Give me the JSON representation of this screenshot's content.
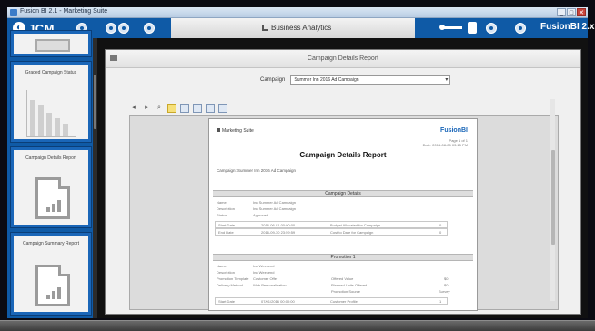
{
  "window": {
    "title": "Fusion BI 2.1 - Marketing Suite",
    "buttons": [
      "_",
      "□",
      "✕"
    ]
  },
  "topbar": {
    "logo": "JCM",
    "center_title": "Business Analytics",
    "brand_right": "FusionBI 2.x"
  },
  "sidebar": {
    "cards": [
      {
        "label": ""
      },
      {
        "label": "Graded Campaign Status"
      },
      {
        "label": "Campaign Details Report"
      },
      {
        "label": "Campaign Summary Report"
      }
    ]
  },
  "panel": {
    "title": "Campaign Details Report",
    "campaign_label": "Campaign",
    "campaign_value": "Summer Inn 2016 Ad Campaign"
  },
  "toolbar": {
    "buttons": [
      "◂",
      "▸",
      "⌕"
    ]
  },
  "report": {
    "brand": "Marketing Suite",
    "logo": "FusionBI",
    "meta": [
      "Page 1 of 1",
      "Date: 2016-08-05 03:15 PM"
    ],
    "title": "Campaign Details Report",
    "campaign_line": "Campaign:   Summer Inn 2016 Ad Campaign",
    "section1": "Campaign Details",
    "details": [
      {
        "k": "Name",
        "v": "Inn Summer Ad Campaign"
      },
      {
        "k": "Description",
        "v": "Inn Summer Ad Campaign"
      },
      {
        "k": "Status",
        "v": "Approved"
      }
    ],
    "date_rows": [
      {
        "k": "Start Date",
        "v": "2016-06-01 00:00:00",
        "k2": "Budget Allocated for Campaign",
        "v2": "0"
      },
      {
        "k": "End Date",
        "v": "2016-09-30 23:59:59",
        "k2": "Cost to Date for Campaign",
        "v2": "0"
      }
    ],
    "section2": "Promotion 1",
    "promo_left": [
      {
        "k": "Name",
        "v": "Inn Weekend"
      },
      {
        "k": "Description",
        "v": "Inn Weekend"
      },
      {
        "k": "Promotion Template",
        "v": "Customer Offer"
      },
      {
        "k": "Delivery Method",
        "v": "Web Personalization"
      }
    ],
    "promo_right": [
      {
        "k": "Offered Value",
        "v": "$0"
      },
      {
        "k": "Planned Units Offered",
        "v": "$0"
      },
      {
        "k": "Promotion Source",
        "v": "Survey"
      }
    ],
    "promo_bottom": {
      "k": "Start Date",
      "v": "07/01/2016 00:00:00",
      "k2": "Customer Profile",
      "v2": "1"
    }
  }
}
